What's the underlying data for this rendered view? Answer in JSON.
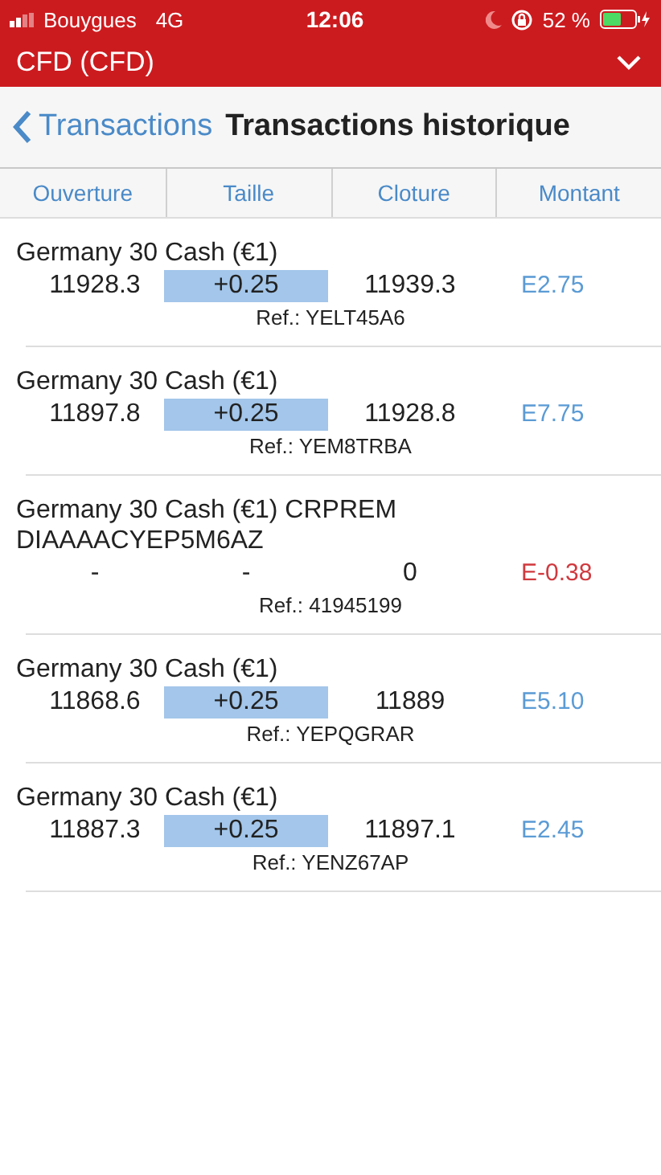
{
  "status_bar": {
    "carrier": "Bouygues",
    "network": "4G",
    "time": "12:06",
    "battery": "52 %"
  },
  "header": {
    "title": "CFD (CFD)"
  },
  "nav": {
    "back": "Transactions",
    "title": "Transactions historique"
  },
  "columns": [
    "Ouverture",
    "Taille",
    "Cloture",
    "Montant"
  ],
  "rows": [
    {
      "name": "Germany 30 Cash (€1)",
      "open": "11928.3",
      "size": "+0.25",
      "size_highlighted": true,
      "close": "11939.3",
      "amount": "E2.75",
      "color": "#5b9bd5",
      "ref": "Ref.: YELT45A6"
    },
    {
      "name": "Germany 30 Cash (€1)",
      "open": "11897.8",
      "size": "+0.25",
      "size_highlighted": true,
      "close": "11928.8",
      "amount": "E7.75",
      "color": "#5b9bd5",
      "ref": "Ref.: YEM8TRBA"
    },
    {
      "name": "Germany 30 Cash (€1) CRPREM DIAAAACYEP5M6AZ",
      "open": "-",
      "size": "-",
      "size_highlighted": false,
      "close": "0",
      "amount": "E-0.38",
      "color": "#d0393e",
      "ref": "Ref.: 41945199"
    },
    {
      "name": "Germany 30 Cash (€1)",
      "open": "11868.6",
      "size": "+0.25",
      "size_highlighted": true,
      "close": "11889",
      "amount": "E5.10",
      "color": "#5b9bd5",
      "ref": "Ref.: YEPQGRAR"
    },
    {
      "name": "Germany 30 Cash (€1)",
      "open": "11887.3",
      "size": "+0.25",
      "size_highlighted": true,
      "close": "11897.1",
      "amount": "E2.45",
      "color": "#5b9bd5",
      "ref": "Ref.: YENZ67AP"
    }
  ]
}
